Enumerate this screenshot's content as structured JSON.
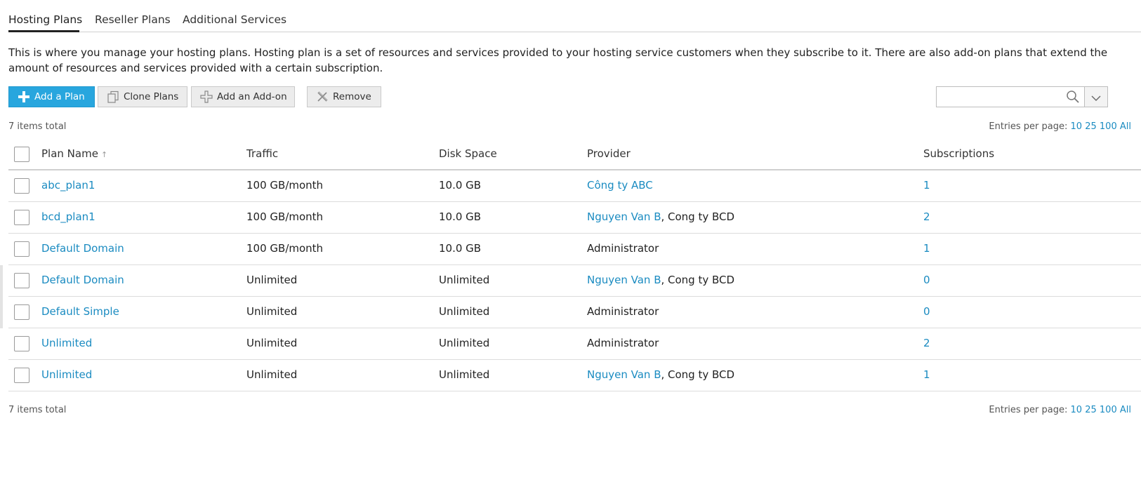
{
  "tabs": [
    {
      "label": "Hosting Plans",
      "active": true
    },
    {
      "label": "Reseller Plans",
      "active": false
    },
    {
      "label": "Additional Services",
      "active": false
    }
  ],
  "intro": "This is where you manage your hosting plans. Hosting plan is a set of resources and services provided to your hosting service customers when they subscribe to it. There are also add-on plans that extend the amount of resources and services provided with a certain subscription.",
  "toolbar": {
    "add_plan": {
      "label": "Add a Plan",
      "icon": "plus-icon"
    },
    "clone_plans": {
      "label": "Clone Plans",
      "icon": "clone-icon"
    },
    "add_addon": {
      "label": "Add an Add-on",
      "icon": "addon-plus-icon"
    },
    "remove": {
      "label": "Remove",
      "icon": "remove-x-icon"
    }
  },
  "search": {
    "placeholder": "",
    "value": ""
  },
  "summary": {
    "items_total": "7 items total",
    "entries_label": "Entries per page:",
    "entries_options": [
      "10",
      "25",
      "100",
      "All"
    ]
  },
  "table": {
    "columns": [
      "Plan Name",
      "Traffic",
      "Disk Space",
      "Provider",
      "Subscriptions"
    ],
    "sorted_by": "Plan Name",
    "rows": [
      {
        "name": "abc_plan1",
        "traffic": "100 GB/month",
        "disk": "10.0 GB",
        "provider_link": "Công ty ABC",
        "provider_rest": "",
        "subs": "1"
      },
      {
        "name": "bcd_plan1",
        "traffic": "100 GB/month",
        "disk": "10.0 GB",
        "provider_link": "Nguyen Van B",
        "provider_rest": ", Cong ty BCD",
        "subs": "2"
      },
      {
        "name": "Default Domain",
        "traffic": "100 GB/month",
        "disk": "10.0 GB",
        "provider_link": "",
        "provider_rest": "Administrator",
        "subs": "1"
      },
      {
        "name": "Default Domain",
        "traffic": "Unlimited",
        "disk": "Unlimited",
        "provider_link": "Nguyen Van B",
        "provider_rest": ", Cong ty BCD",
        "subs": "0"
      },
      {
        "name": "Default Simple",
        "traffic": "Unlimited",
        "disk": "Unlimited",
        "provider_link": "",
        "provider_rest": "Administrator",
        "subs": "0"
      },
      {
        "name": "Unlimited",
        "traffic": "Unlimited",
        "disk": "Unlimited",
        "provider_link": "",
        "provider_rest": "Administrator",
        "subs": "2"
      },
      {
        "name": "Unlimited",
        "traffic": "Unlimited",
        "disk": "Unlimited",
        "provider_link": "Nguyen Van B",
        "provider_rest": ", Cong ty BCD",
        "subs": "1"
      }
    ]
  },
  "colors": {
    "accent": "#28a6de",
    "link": "#1a8bc1"
  }
}
